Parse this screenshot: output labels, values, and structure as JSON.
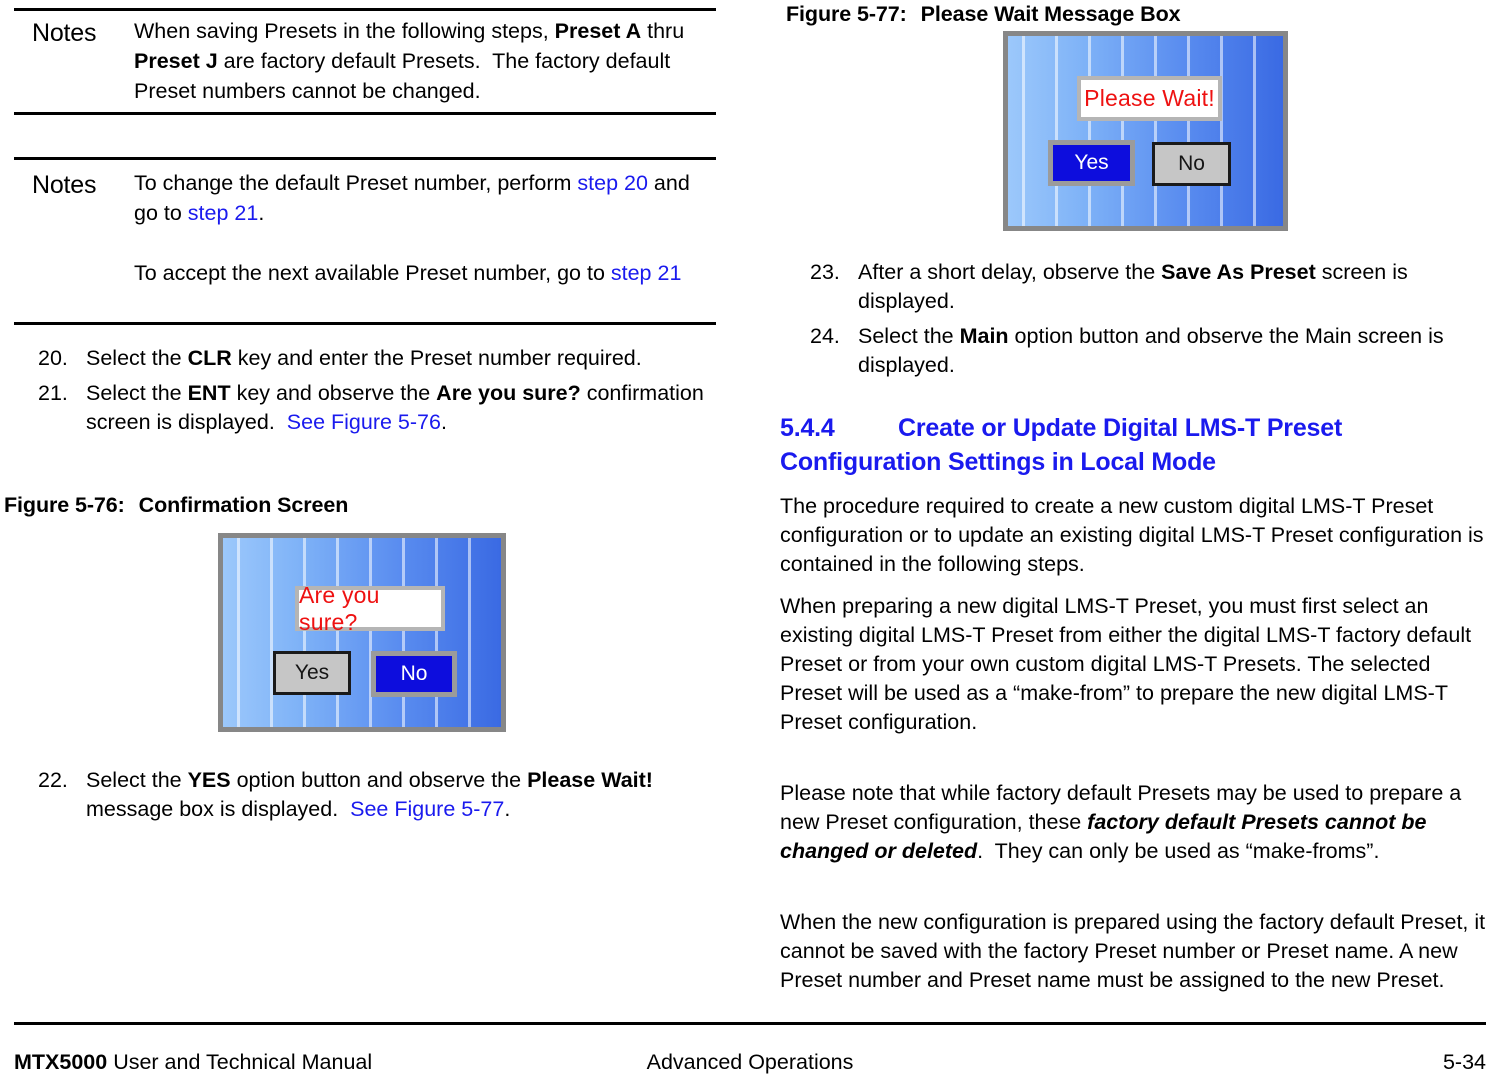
{
  "document": {
    "title": "MTX5000 User and Technical Manual",
    "section": "Advanced Operations",
    "page_number": "5-34"
  },
  "footer": {
    "brand": "MTX5000",
    "manual": " User and Technical Manual",
    "center": "Advanced Operations",
    "page": "5-34"
  },
  "left_column": {
    "note_1": {
      "label": "Notes",
      "text_parts": [
        {
          "t": "When saving Presets in the following steps, ",
          "style": "normal"
        },
        {
          "t": "Preset A",
          "style": "bold"
        },
        {
          "t": " thru ",
          "style": "normal"
        },
        {
          "t": "Preset J",
          "style": "bold"
        },
        {
          "t": " are factory default Presets.  The factory default Preset numbers cannot be changed.",
          "style": "normal"
        }
      ],
      "plain": "When saving Presets in the following steps, Preset A thru Preset J are factory default Presets.  The factory default Preset numbers cannot be changed."
    },
    "note_2": {
      "label": "Notes",
      "paragraph_1_parts": [
        {
          "t": "To change the default Preset number, perform ",
          "style": "normal"
        },
        {
          "t": "step 20",
          "style": "xref"
        },
        {
          "t": " and go to ",
          "style": "normal"
        },
        {
          "t": "step 21",
          "style": "xref"
        },
        {
          "t": ".",
          "style": "normal"
        }
      ],
      "paragraph_2_parts": [
        {
          "t": "To accept the next available Preset number, go to ",
          "style": "normal"
        },
        {
          "t": "step 21",
          "style": "xref"
        }
      ],
      "plain_1": "To change the default Preset number, perform step 20 and go to step 21.",
      "plain_2": "To accept the next available Preset number, go to step 21"
    },
    "steps": [
      {
        "number": "20.",
        "parts": [
          {
            "t": "Select the ",
            "style": "normal"
          },
          {
            "t": "CLR",
            "style": "bold"
          },
          {
            "t": " key and enter the Preset number required.",
            "style": "normal"
          }
        ],
        "plain": "Select the CLR key and enter the Preset number required."
      },
      {
        "number": "21.",
        "parts": [
          {
            "t": "Select the ",
            "style": "normal"
          },
          {
            "t": "ENT",
            "style": "bold"
          },
          {
            "t": " key and observe the ",
            "style": "normal"
          },
          {
            "t": "Are you sure?",
            "style": "bold"
          },
          {
            "t": " confirmation screen is displayed.  ",
            "style": "normal"
          },
          {
            "t": "See Figure 5-76",
            "style": "xref"
          },
          {
            "t": ".",
            "style": "normal"
          }
        ],
        "plain": "Select the ENT key and observe the Are you sure? confirmation screen is displayed.  See Figure 5-76."
      },
      {
        "number": "22.",
        "parts": [
          {
            "t": "Select the ",
            "style": "normal"
          },
          {
            "t": "YES",
            "style": "bold"
          },
          {
            "t": " option button and observe the ",
            "style": "normal"
          },
          {
            "t": "Please Wait!",
            "style": "bold"
          },
          {
            "t": " message box is displayed.  ",
            "style": "normal"
          },
          {
            "t": "See Figure 5-77",
            "style": "xref"
          },
          {
            "t": ".",
            "style": "normal"
          }
        ],
        "plain": "Select the YES option button and observe the Please Wait! message box is displayed.  See Figure 5-77."
      }
    ],
    "figure_5_76": {
      "caption_number": "Figure 5-76:",
      "caption_title": "Confirmation Screen",
      "message": "Are you sure?",
      "buttons": [
        {
          "label": "Yes",
          "state": "inactive"
        },
        {
          "label": "No",
          "state": "active"
        }
      ]
    }
  },
  "right_column": {
    "figure_5_77": {
      "caption_number": "Figure 5-77:",
      "caption_title": "Please Wait Message Box",
      "message": "Please Wait!",
      "buttons": [
        {
          "label": "Yes",
          "state": "active"
        },
        {
          "label": "No",
          "state": "inactive"
        }
      ]
    },
    "steps": [
      {
        "number": "23.",
        "parts": [
          {
            "t": "After a short delay, observe the ",
            "style": "normal"
          },
          {
            "t": "Save As Preset",
            "style": "bold"
          },
          {
            "t": " screen is displayed.",
            "style": "normal"
          }
        ],
        "plain": "After a short delay, observe the Save As Preset screen is displayed."
      },
      {
        "number": "24.",
        "parts": [
          {
            "t": "Select the ",
            "style": "normal"
          },
          {
            "t": "Main",
            "style": "bold"
          },
          {
            "t": " option button and observe the Main screen is displayed.",
            "style": "normal"
          }
        ],
        "plain": "Select the Main option button and observe the Main screen is displayed."
      }
    ],
    "heading": {
      "number": "5.4.4",
      "title": "Create or Update Digital LMS-T Preset Configuration Settings in Local Mode"
    },
    "paragraphs": [
      {
        "id": "p1",
        "parts": [
          {
            "t": "The procedure required to create a new custom digital LMS-T Preset configuration or to update an existing digital LMS-T Preset configuration is contained in the following steps.",
            "style": "normal"
          }
        ],
        "plain": "The procedure required to create a new custom digital LMS-T Preset configuration or to update an existing digital LMS-T Preset configuration is contained in the following steps."
      },
      {
        "id": "p2",
        "parts": [
          {
            "t": "When preparing a new digital LMS-T Preset, you must first select an existing digital LMS-T Preset from either the digital LMS-T factory default Preset or from your own custom digital LMS-T Presets.  The selected Preset will be used as a “make-from” to prepare the new digital LMS-T Preset configuration.",
            "style": "normal"
          }
        ],
        "plain": "When preparing a new digital LMS-T Preset, you must first select an existing digital LMS-T Preset from either the digital LMS-T factory default Preset or from your own custom digital LMS-T Presets.  The selected Preset will be used as a “make-from” to prepare the new digital LMS-T Preset configuration."
      },
      {
        "id": "p3",
        "parts": [
          {
            "t": "Please note that while factory default Presets may be used to prepare a new Preset configuration, these ",
            "style": "normal"
          },
          {
            "t": "factory default Presets cannot be changed or deleted",
            "style": "bold-italic"
          },
          {
            "t": ".  They can only be used as “make-froms”.",
            "style": "normal"
          }
        ],
        "plain": "Please note that while factory default Presets may be used to prepare a new Preset configuration, these factory default Presets cannot be changed or deleted.  They can only be used as “make-froms”."
      },
      {
        "id": "p4",
        "parts": [
          {
            "t": "When the new configuration is prepared using the factory default Preset, it cannot be saved with the factory Preset number or Preset name.  A new Preset number and Preset name must be assigned to the new Preset.",
            "style": "normal"
          }
        ],
        "plain": "When the new configuration is prepared using the factory default Preset, it cannot be saved with the factory Preset number or Preset name.  A new Preset number and Preset name must be assigned to the new Preset."
      }
    ]
  },
  "colors": {
    "xref_blue": "#1a1aee",
    "heading_blue": "#1a1aee",
    "dialog_message_red": "#ee1111",
    "dialog_button_active": "#0d0ddd",
    "dialog_button_inactive": "#c6c6c6",
    "dialog_bezel": "#878787"
  }
}
